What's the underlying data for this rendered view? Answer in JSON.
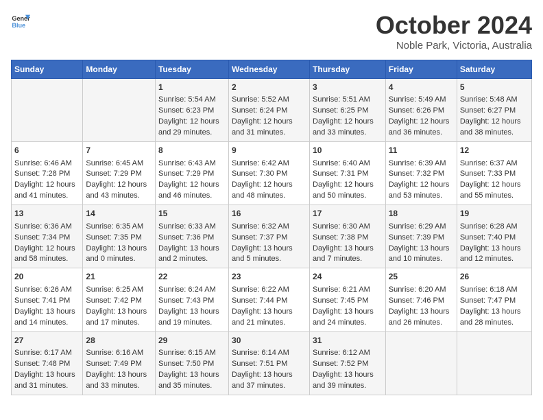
{
  "logo": {
    "general": "General",
    "blue": "Blue"
  },
  "title": {
    "month": "October 2024",
    "location": "Noble Park, Victoria, Australia"
  },
  "headers": [
    "Sunday",
    "Monday",
    "Tuesday",
    "Wednesday",
    "Thursday",
    "Friday",
    "Saturday"
  ],
  "weeks": [
    [
      {
        "day": "",
        "info": ""
      },
      {
        "day": "",
        "info": ""
      },
      {
        "day": "1",
        "info": "Sunrise: 5:54 AM\nSunset: 6:23 PM\nDaylight: 12 hours and 29 minutes."
      },
      {
        "day": "2",
        "info": "Sunrise: 5:52 AM\nSunset: 6:24 PM\nDaylight: 12 hours and 31 minutes."
      },
      {
        "day": "3",
        "info": "Sunrise: 5:51 AM\nSunset: 6:25 PM\nDaylight: 12 hours and 33 minutes."
      },
      {
        "day": "4",
        "info": "Sunrise: 5:49 AM\nSunset: 6:26 PM\nDaylight: 12 hours and 36 minutes."
      },
      {
        "day": "5",
        "info": "Sunrise: 5:48 AM\nSunset: 6:27 PM\nDaylight: 12 hours and 38 minutes."
      }
    ],
    [
      {
        "day": "6",
        "info": "Sunrise: 6:46 AM\nSunset: 7:28 PM\nDaylight: 12 hours and 41 minutes."
      },
      {
        "day": "7",
        "info": "Sunrise: 6:45 AM\nSunset: 7:29 PM\nDaylight: 12 hours and 43 minutes."
      },
      {
        "day": "8",
        "info": "Sunrise: 6:43 AM\nSunset: 7:29 PM\nDaylight: 12 hours and 46 minutes."
      },
      {
        "day": "9",
        "info": "Sunrise: 6:42 AM\nSunset: 7:30 PM\nDaylight: 12 hours and 48 minutes."
      },
      {
        "day": "10",
        "info": "Sunrise: 6:40 AM\nSunset: 7:31 PM\nDaylight: 12 hours and 50 minutes."
      },
      {
        "day": "11",
        "info": "Sunrise: 6:39 AM\nSunset: 7:32 PM\nDaylight: 12 hours and 53 minutes."
      },
      {
        "day": "12",
        "info": "Sunrise: 6:37 AM\nSunset: 7:33 PM\nDaylight: 12 hours and 55 minutes."
      }
    ],
    [
      {
        "day": "13",
        "info": "Sunrise: 6:36 AM\nSunset: 7:34 PM\nDaylight: 12 hours and 58 minutes."
      },
      {
        "day": "14",
        "info": "Sunrise: 6:35 AM\nSunset: 7:35 PM\nDaylight: 13 hours and 0 minutes."
      },
      {
        "day": "15",
        "info": "Sunrise: 6:33 AM\nSunset: 7:36 PM\nDaylight: 13 hours and 2 minutes."
      },
      {
        "day": "16",
        "info": "Sunrise: 6:32 AM\nSunset: 7:37 PM\nDaylight: 13 hours and 5 minutes."
      },
      {
        "day": "17",
        "info": "Sunrise: 6:30 AM\nSunset: 7:38 PM\nDaylight: 13 hours and 7 minutes."
      },
      {
        "day": "18",
        "info": "Sunrise: 6:29 AM\nSunset: 7:39 PM\nDaylight: 13 hours and 10 minutes."
      },
      {
        "day": "19",
        "info": "Sunrise: 6:28 AM\nSunset: 7:40 PM\nDaylight: 13 hours and 12 minutes."
      }
    ],
    [
      {
        "day": "20",
        "info": "Sunrise: 6:26 AM\nSunset: 7:41 PM\nDaylight: 13 hours and 14 minutes."
      },
      {
        "day": "21",
        "info": "Sunrise: 6:25 AM\nSunset: 7:42 PM\nDaylight: 13 hours and 17 minutes."
      },
      {
        "day": "22",
        "info": "Sunrise: 6:24 AM\nSunset: 7:43 PM\nDaylight: 13 hours and 19 minutes."
      },
      {
        "day": "23",
        "info": "Sunrise: 6:22 AM\nSunset: 7:44 PM\nDaylight: 13 hours and 21 minutes."
      },
      {
        "day": "24",
        "info": "Sunrise: 6:21 AM\nSunset: 7:45 PM\nDaylight: 13 hours and 24 minutes."
      },
      {
        "day": "25",
        "info": "Sunrise: 6:20 AM\nSunset: 7:46 PM\nDaylight: 13 hours and 26 minutes."
      },
      {
        "day": "26",
        "info": "Sunrise: 6:18 AM\nSunset: 7:47 PM\nDaylight: 13 hours and 28 minutes."
      }
    ],
    [
      {
        "day": "27",
        "info": "Sunrise: 6:17 AM\nSunset: 7:48 PM\nDaylight: 13 hours and 31 minutes."
      },
      {
        "day": "28",
        "info": "Sunrise: 6:16 AM\nSunset: 7:49 PM\nDaylight: 13 hours and 33 minutes."
      },
      {
        "day": "29",
        "info": "Sunrise: 6:15 AM\nSunset: 7:50 PM\nDaylight: 13 hours and 35 minutes."
      },
      {
        "day": "30",
        "info": "Sunrise: 6:14 AM\nSunset: 7:51 PM\nDaylight: 13 hours and 37 minutes."
      },
      {
        "day": "31",
        "info": "Sunrise: 6:12 AM\nSunset: 7:52 PM\nDaylight: 13 hours and 39 minutes."
      },
      {
        "day": "",
        "info": ""
      },
      {
        "day": "",
        "info": ""
      }
    ]
  ]
}
